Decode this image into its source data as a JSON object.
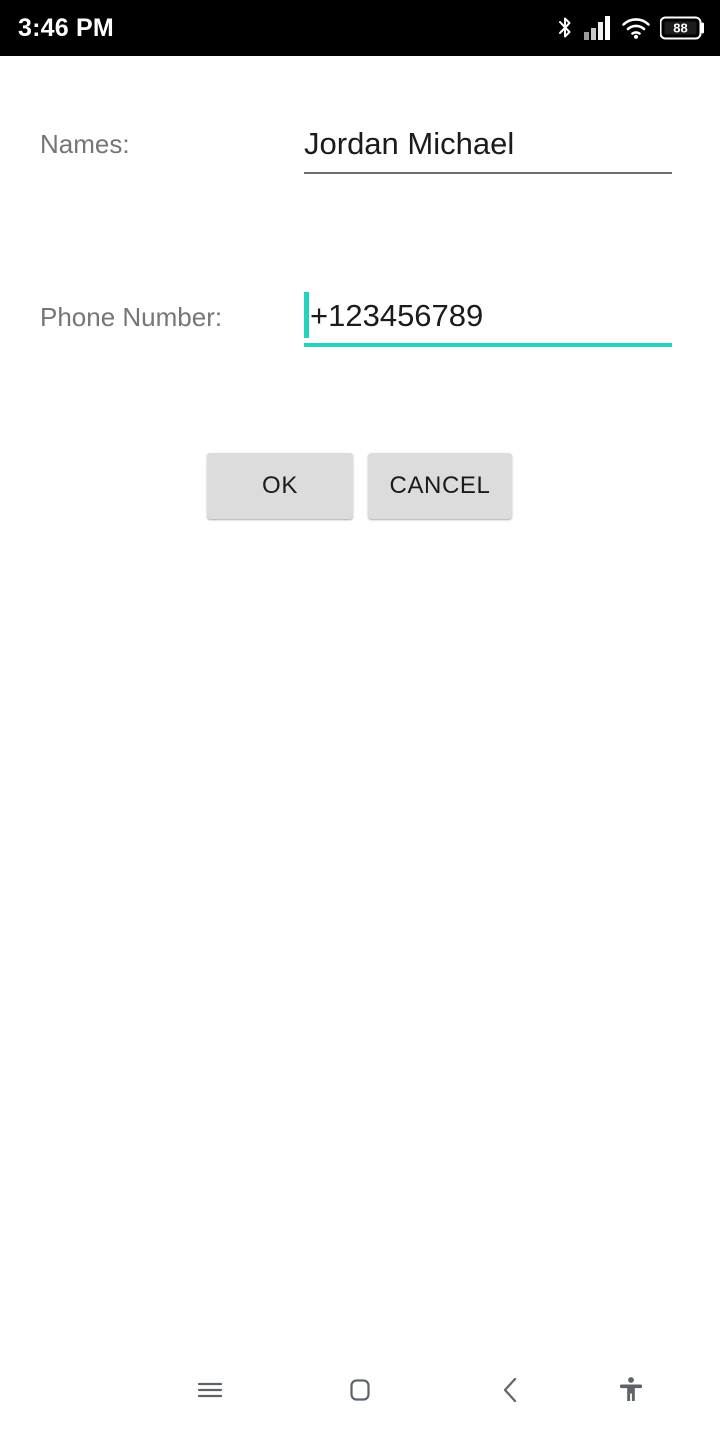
{
  "status_bar": {
    "clock": "3:46 PM",
    "background_color": "#000000",
    "text_color": "#ffffff",
    "icons": [
      {
        "name": "bluetooth-icon",
        "label": "Bluetooth"
      },
      {
        "name": "cellular-signal-icon",
        "label": "Signal",
        "bars_total": 4,
        "bars_active": 4
      },
      {
        "name": "wifi-icon",
        "label": "Wi-Fi"
      },
      {
        "name": "battery-icon",
        "label": "Battery",
        "percent": "88"
      }
    ]
  },
  "form": {
    "fields": [
      {
        "label": "Names:",
        "value": "Jordan Michael",
        "focused": false,
        "underline_color": "#6e6e6e"
      },
      {
        "label": "Phone Number:",
        "value": "+123456789",
        "focused": true,
        "underline_color": "#24d3bd"
      }
    ]
  },
  "buttons": {
    "ok_label": "OK",
    "cancel_label": "CANCEL",
    "background_color": "#dcdcdc",
    "text_color": "#1b1b1b"
  },
  "navigation_bar": {
    "items": [
      {
        "name": "recents-button",
        "label": "Recents"
      },
      {
        "name": "home-button",
        "label": "Home"
      },
      {
        "name": "back-button",
        "label": "Back"
      },
      {
        "name": "accessibility-button",
        "label": "Accessibility"
      }
    ],
    "icon_color": "#5f6368"
  },
  "theme": {
    "accent_color": "#24d3bd",
    "page_background": "#ffffff",
    "label_color": "#767676",
    "value_color": "#1b1b1b"
  }
}
